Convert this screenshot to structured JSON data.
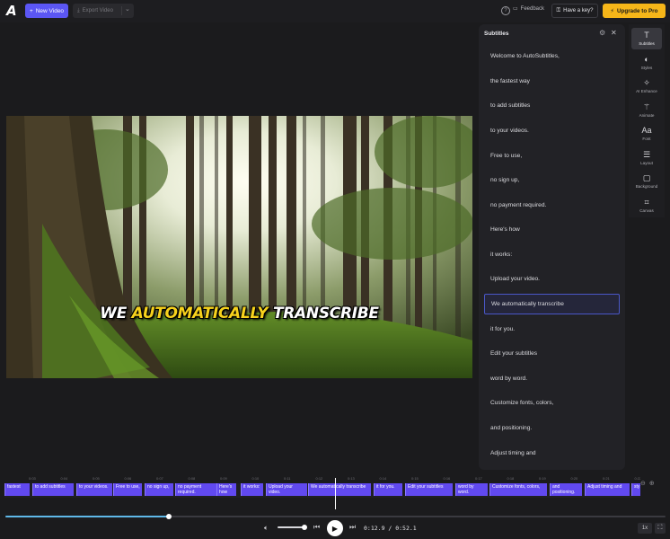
{
  "topbar": {
    "logo": "A",
    "new_video": "New Video",
    "export_video": "Export Video",
    "feedback": "Feedback",
    "have_key": "Have a key?",
    "upgrade": "Upgrade to Pro",
    "help_icon": "?"
  },
  "caption": {
    "word1": "WE",
    "word2": "AUTOMATICALLY",
    "word3": "TRANSCRIBE",
    "highlight_color": "#f7d21c"
  },
  "panel": {
    "title": "Subtitles",
    "items": [
      "Welcome to AutoSubtitles,",
      "the fastest way",
      "to add subtitles",
      "to your videos.",
      "Free to use,",
      "no sign up,",
      "no payment required.",
      "Here's how",
      "it works:",
      "Upload your video.",
      "We automatically transcribe",
      "it for you.",
      "Edit your subtitles",
      "word by word.",
      "Customize fonts, colors,",
      "and positioning.",
      "Adjust timing and"
    ],
    "active_index": 10
  },
  "rail": [
    {
      "label": "Subtitles",
      "icon": "text-icon",
      "active": true
    },
    {
      "label": "Styles",
      "icon": "palette-icon",
      "active": false
    },
    {
      "label": "AI Enhance",
      "icon": "sparkle-icon",
      "active": false
    },
    {
      "label": "Animate",
      "icon": "wand-icon",
      "active": false
    },
    {
      "label": "Font",
      "icon": "font-icon",
      "active": false
    },
    {
      "label": "Layout",
      "icon": "layout-icon",
      "active": false
    },
    {
      "label": "Background",
      "icon": "square-icon",
      "active": false
    },
    {
      "label": "Canvas",
      "icon": "crop-icon",
      "active": false
    }
  ],
  "timeline": {
    "ruler": [
      "0:03",
      "0:04",
      "0:05",
      "0:06",
      "0:07",
      "0:08",
      "0:09",
      "0:10",
      "0:11",
      "0:12",
      "0:13",
      "0:14",
      "0:15",
      "0:16",
      "0:17",
      "0:18",
      "0:19",
      "0:20",
      "0:21",
      "0:22"
    ],
    "segments": [
      "fastest",
      "to add subtitles",
      "to your videos.",
      "Free to use,",
      "no sign up,",
      "no payment required.",
      "Here's how",
      "it works:",
      "Upload your video.",
      "We automatically transcribe",
      "it for you.",
      "Edit your subtitles",
      "word by word.",
      "Customize fonts, colors,",
      "and positioning.",
      "Adjust timing and",
      "sty"
    ]
  },
  "player": {
    "current": "0:12.9",
    "total": "0:52.1",
    "separator": " / ",
    "speed": "1x",
    "progress_fraction": 0.248,
    "volume_fraction": 0.85
  },
  "colors": {
    "accent": "#5b56f4",
    "pro": "#f6b619",
    "segment": "#6149f0",
    "progress": "#5fb8e8"
  }
}
